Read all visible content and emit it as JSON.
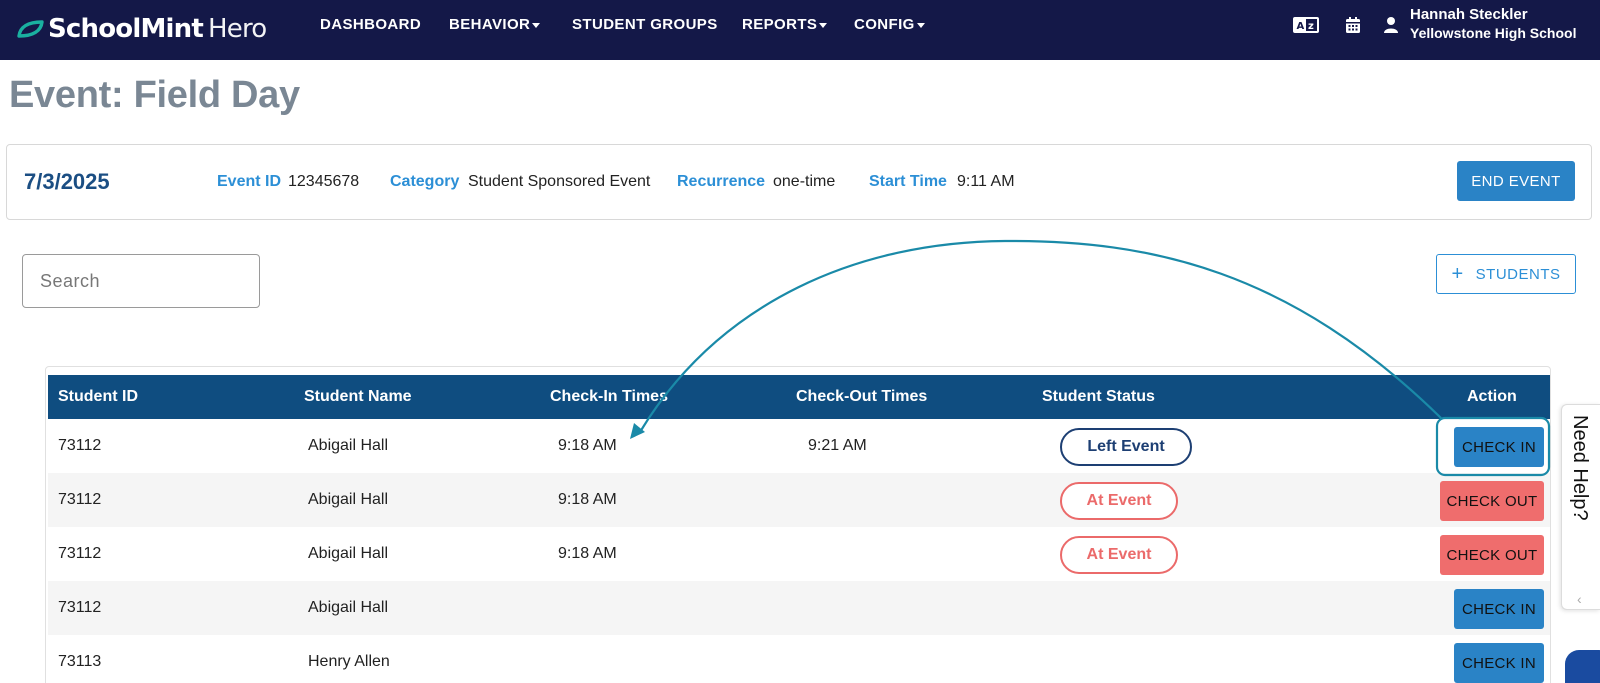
{
  "app": {
    "brand_bold": "SchoolMint",
    "brand_light": "Hero",
    "brand_color": "#1ab0a0"
  },
  "nav": {
    "items": [
      {
        "label": "DASHBOARD",
        "dropdown": false
      },
      {
        "label": "BEHAVIOR",
        "dropdown": true
      },
      {
        "label": "STUDENT GROUPS",
        "dropdown": false
      },
      {
        "label": "REPORTS",
        "dropdown": true
      },
      {
        "label": "CONFIG",
        "dropdown": true
      }
    ],
    "icons": [
      "translate-icon",
      "calendar-icon",
      "user-icon"
    ],
    "user": {
      "name": "Hannah Steckler",
      "school": "Yellowstone High School"
    }
  },
  "page": {
    "title": "Event: Field Day"
  },
  "event": {
    "date": "7/3/2025",
    "id_label": "Event ID",
    "id_value": "12345678",
    "category_label": "Category",
    "category_value": "Student Sponsored Event",
    "recurrence_label": "Recurrence",
    "recurrence_value": "one-time",
    "start_label": "Start Time",
    "start_value": "9:11 AM",
    "end_button": "END EVENT"
  },
  "search": {
    "placeholder": "Search",
    "value": ""
  },
  "add_students": {
    "label": "STUDENTS"
  },
  "table": {
    "headers": [
      "Student ID",
      "Student Name",
      "Check-In Times",
      "Check-Out Times",
      "Student Status",
      "Action"
    ],
    "rows": [
      {
        "id": "73112",
        "name": "Abigail Hall",
        "checkin": "9:18 AM",
        "checkout": "9:21 AM",
        "status": "Left Event",
        "action": "CHECK IN"
      },
      {
        "id": "73112",
        "name": "Abigail Hall",
        "checkin": "9:18 AM",
        "checkout": "",
        "status": "At Event",
        "action": "CHECK OUT"
      },
      {
        "id": "73112",
        "name": "Abigail Hall",
        "checkin": "9:18 AM",
        "checkout": "",
        "status": "At Event",
        "action": "CHECK OUT"
      },
      {
        "id": "73112",
        "name": "Abigail Hall",
        "checkin": "",
        "checkout": "",
        "status": "",
        "action": "CHECK IN"
      },
      {
        "id": "73113",
        "name": "Henry Allen",
        "checkin": "",
        "checkout": "",
        "status": "",
        "action": "CHECK IN"
      }
    ]
  },
  "help": {
    "label": "Need Help?"
  },
  "colors": {
    "nav_bg": "#141848",
    "header_bg": "#0f4d80",
    "accent": "#2c8fd6",
    "check_in": "#2a83c6",
    "check_out": "#ef6d6d",
    "annotation": "#1a8aa8"
  }
}
